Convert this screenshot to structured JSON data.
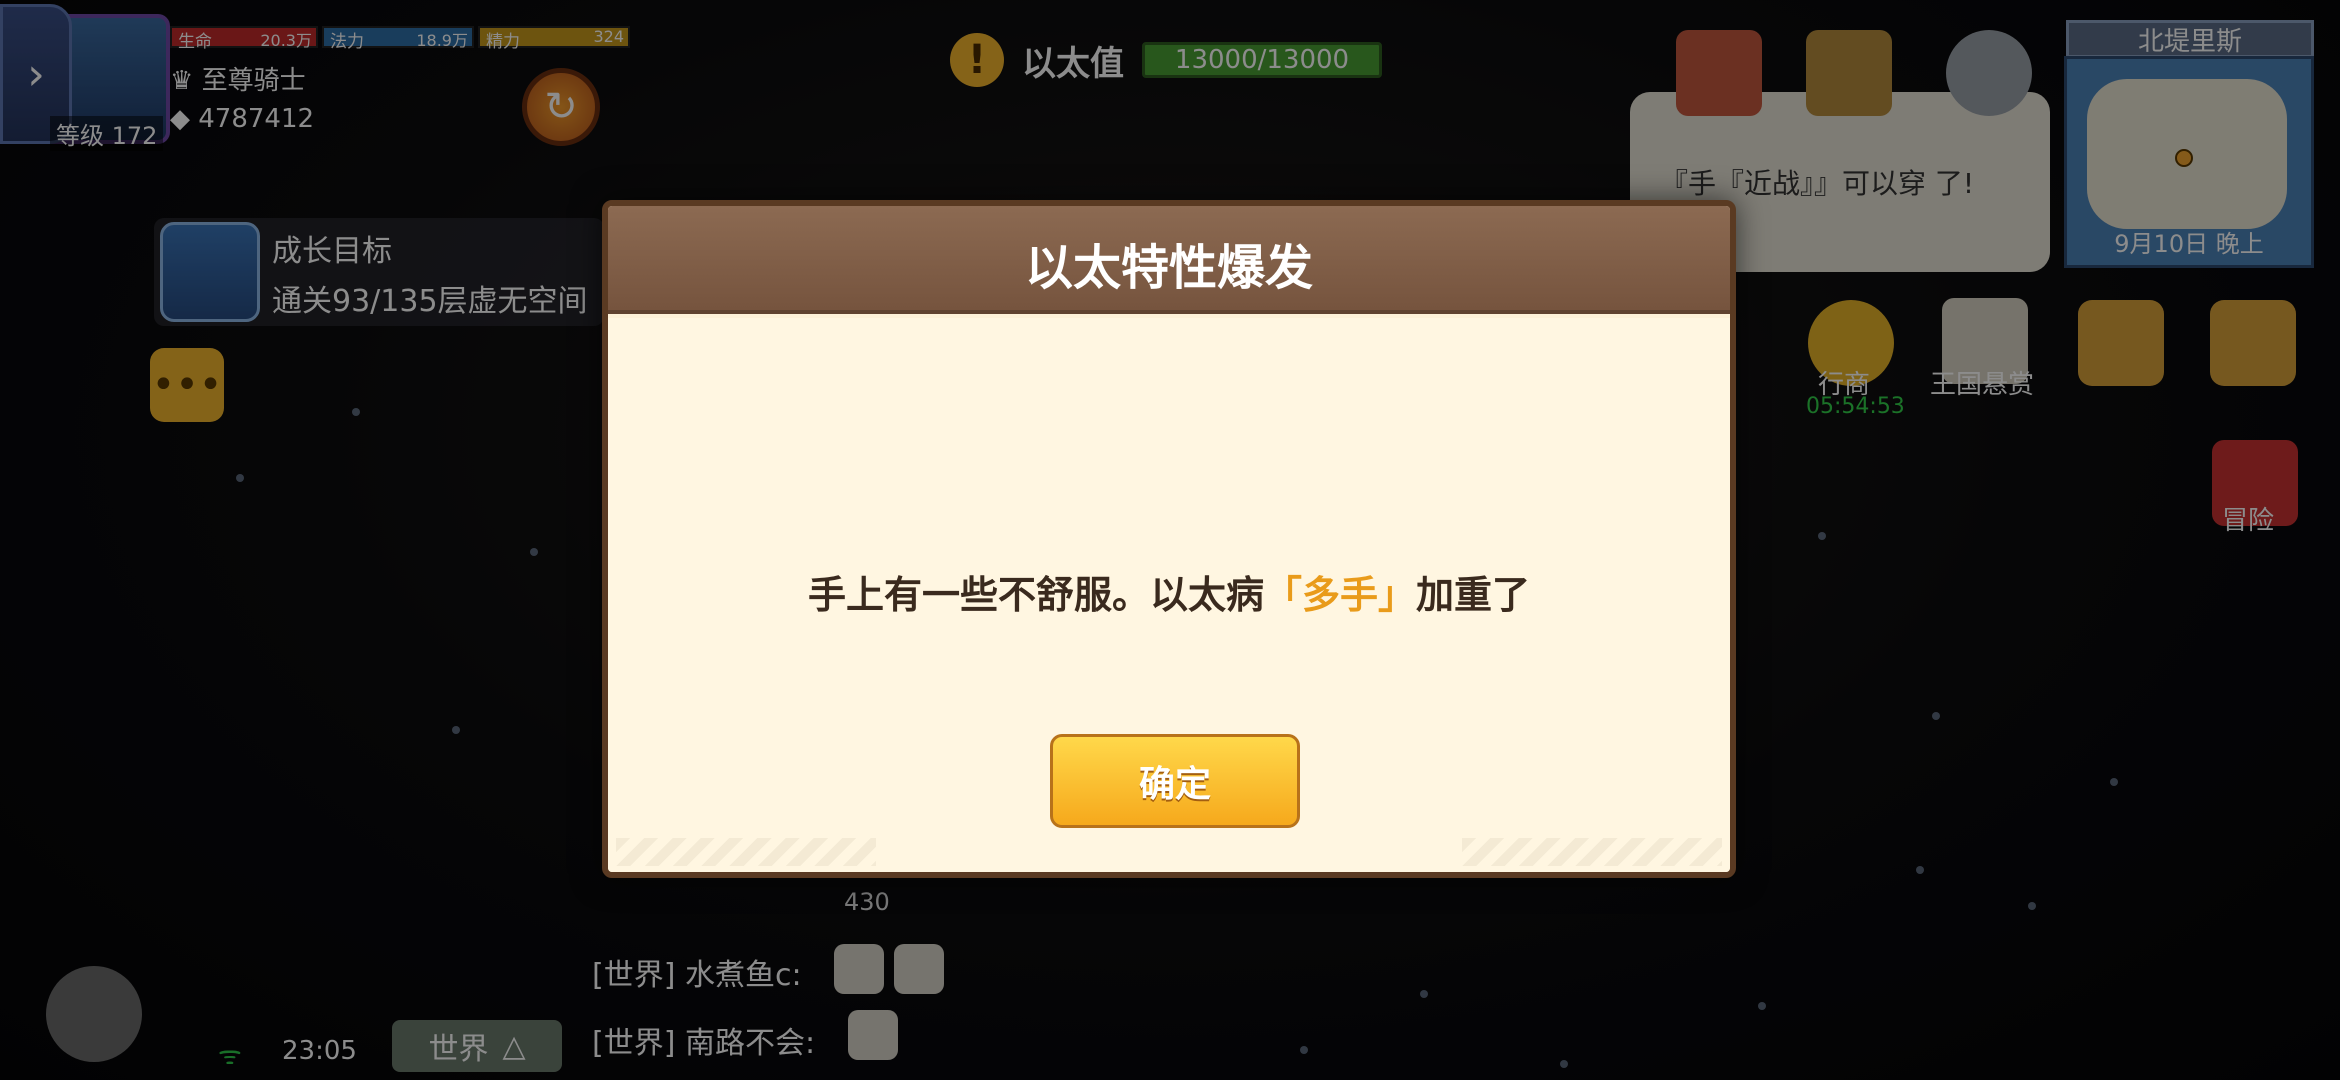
{
  "hud": {
    "level": "等级 172",
    "hp": {
      "name": "生命",
      "value": "20.3万"
    },
    "mp": {
      "name": "法力",
      "value": "18.9万"
    },
    "sp": {
      "name": "精力",
      "value": "324"
    },
    "rank": "至尊骑士",
    "power": "4787412",
    "up_icon": "↻"
  },
  "ether": {
    "label": "以太值",
    "value": "13000/13000",
    "icon": "!"
  },
  "goal": {
    "title": "成长目标",
    "desc": "通关93/135层虚无空间"
  },
  "map": {
    "title": "北堤里斯",
    "date": "9月10日 晚上"
  },
  "speech": "『手『近战』』可以穿\n        了!",
  "right_icons": {
    "merchant": "行商",
    "merchant_timer": "05:54:53",
    "bounty": "王国悬赏",
    "adventure": "冒险"
  },
  "bottom": {
    "time": "23:05",
    "world_tab": "世界",
    "chat": [
      {
        "text": "[世界] 水煮鱼c:"
      },
      {
        "text": "[世界] 南路不会:"
      }
    ],
    "num": "430"
  },
  "dialog": {
    "title": "以太特性爆发",
    "message_prefix": "手上有一些不舒服。以太病",
    "message_highlight": "「多手」",
    "message_suffix": "加重了",
    "confirm": "确定"
  },
  "colors": {
    "hp": "#c22a2a",
    "mp": "#2f6fa8",
    "sp": "#c79a1d",
    "highlight": "#e99b1a",
    "button": "#f6a91c"
  }
}
